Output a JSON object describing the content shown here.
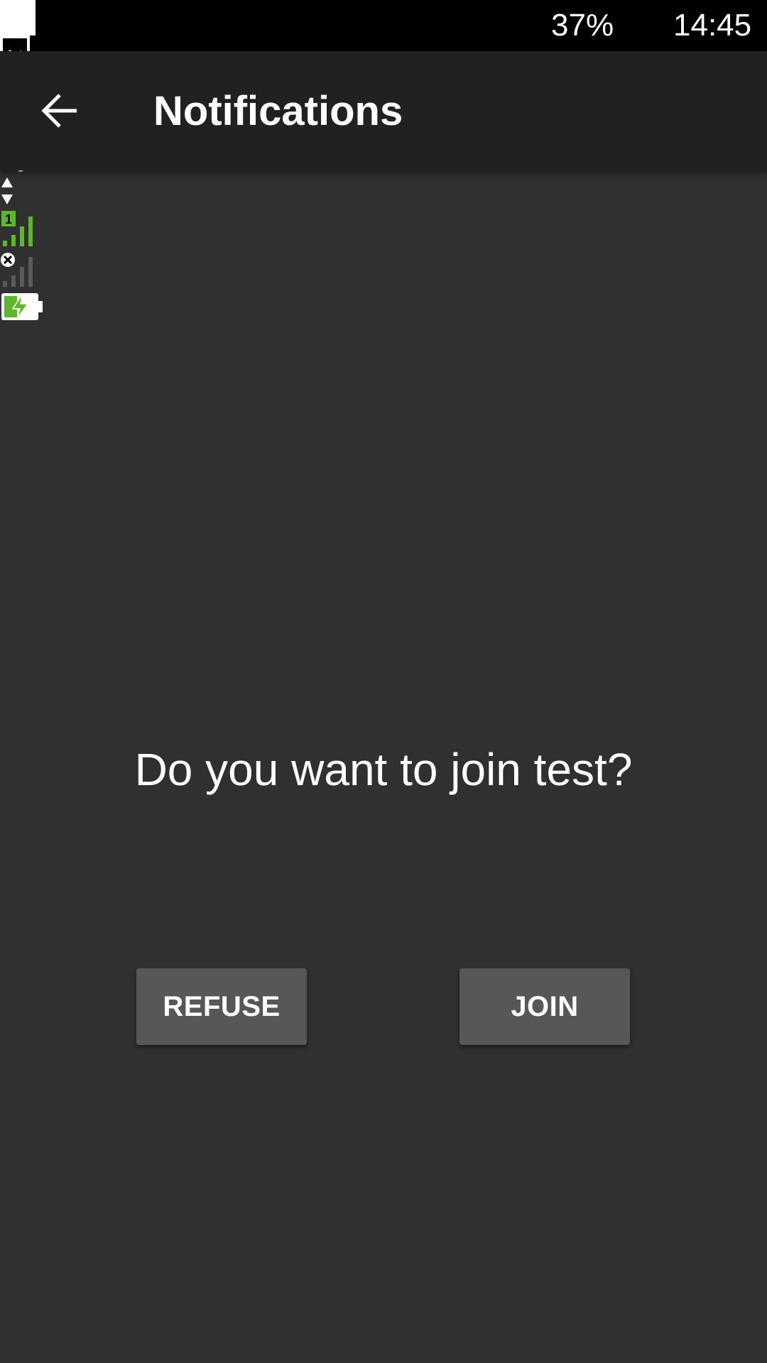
{
  "status_bar": {
    "battery_percent": "37%",
    "time": "14:45",
    "sim_badge": "1",
    "signal_color": "#5cb82a",
    "icons": [
      "white-square-icon",
      "image-icon",
      "android-debug-icon",
      "vibrate-icon",
      "wifi-icon",
      "data-arrows-icon",
      "signal-sim1-icon",
      "signal-sim2-no-service-icon",
      "battery-charging-icon"
    ]
  },
  "app_bar": {
    "back_icon": "arrow-back-icon",
    "title": "Notifications",
    "background": "#212121"
  },
  "dialog": {
    "question": "Do you want to join test?",
    "refuse_label": "REFUSE",
    "join_label": "JOIN"
  },
  "colors": {
    "background": "#303030",
    "button": "#575757",
    "text": "#ffffff"
  }
}
